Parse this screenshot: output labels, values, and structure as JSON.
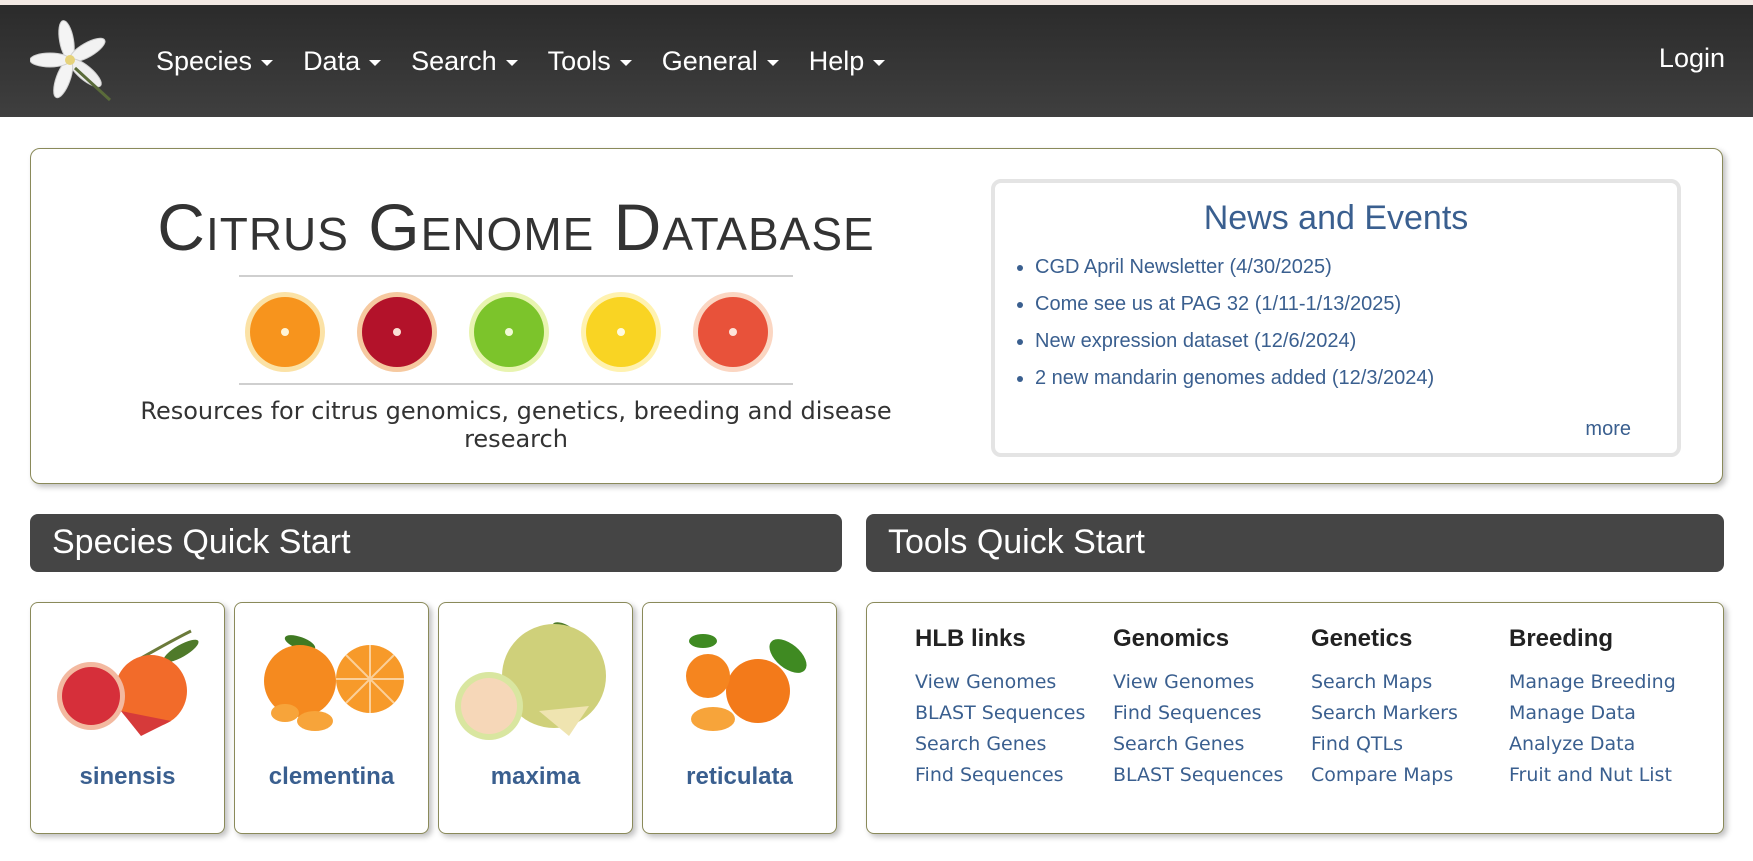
{
  "nav": {
    "items": [
      {
        "label": "Species"
      },
      {
        "label": "Data"
      },
      {
        "label": "Search"
      },
      {
        "label": "Tools"
      },
      {
        "label": "General"
      },
      {
        "label": "Help"
      }
    ],
    "login": "Login"
  },
  "hero": {
    "title": "Citrus Genome Database",
    "subtitle": "Resources for citrus genomics, genetics, breeding and disease research"
  },
  "news": {
    "title": "News and Events",
    "items": [
      "CGD April Newsletter (4/30/2025)",
      "Come see us at PAG 32 (1/11-1/13/2025)",
      "New expression dataset (12/6/2024)",
      "2 new mandarin genomes added (12/3/2024)"
    ],
    "more": "more"
  },
  "species_quick_start": {
    "title": "Species Quick Start",
    "species": [
      "sinensis",
      "clementina",
      "maxima",
      "reticulata"
    ]
  },
  "tools_quick_start": {
    "title": "Tools Quick Start",
    "columns": [
      {
        "heading": "HLB links",
        "links": [
          "View Genomes",
          "BLAST Sequences",
          "Search Genes",
          "Find Sequences"
        ]
      },
      {
        "heading": "Genomics",
        "links": [
          "View Genomes",
          "Find Sequences",
          "Search Genes",
          "BLAST Sequences"
        ]
      },
      {
        "heading": "Genetics",
        "links": [
          "Search Maps",
          "Search Markers",
          "Find QTLs",
          "Compare Maps"
        ]
      },
      {
        "heading": "Breeding",
        "links": [
          "Manage Breeding",
          "Manage Data",
          "Analyze Data",
          "Fruit and Nut List"
        ]
      }
    ]
  },
  "colors": {
    "navbar": "#3a3a3a",
    "link": "#3a5f8f",
    "section_bar": "#454545"
  }
}
